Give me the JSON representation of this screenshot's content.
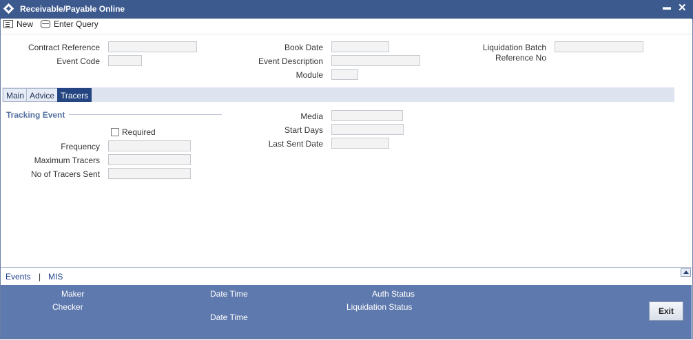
{
  "window": {
    "title": "Receivable/Payable Online",
    "minimize_label": "▬",
    "close_label": "✕"
  },
  "toolbar": {
    "new_label": "New",
    "enter_query_label": "Enter Query"
  },
  "header": {
    "contract_reference_label": "Contract Reference",
    "event_code_label": "Event Code",
    "book_date_label": "Book Date",
    "event_description_label": "Event Description",
    "module_label": "Module",
    "liquidation_batch_label_1": "Liquidation Batch",
    "liquidation_batch_label_2": "Reference No",
    "contract_reference_value": "",
    "event_code_value": "",
    "book_date_value": "",
    "event_description_value": "",
    "module_value": "",
    "liquidation_batch_value": ""
  },
  "tabs": [
    {
      "label": "Main",
      "active": false
    },
    {
      "label": "Advice",
      "active": false
    },
    {
      "label": "Tracers",
      "active": true
    }
  ],
  "tracers": {
    "section_title": "Tracking Event",
    "required_label": "Required",
    "required_checked": false,
    "frequency_label": "Frequency",
    "maximum_tracers_label": "Maximum Tracers",
    "tracers_sent_label": "No of Tracers Sent",
    "media_label": "Media",
    "start_days_label": "Start Days",
    "last_sent_date_label": "Last Sent Date",
    "frequency_value": "",
    "maximum_tracers_value": "",
    "tracers_sent_value": "",
    "media_value": "",
    "start_days_value": "",
    "last_sent_date_value": ""
  },
  "bottom_links": {
    "events_label": "Events",
    "separator": "|",
    "mis_label": "MIS"
  },
  "footer": {
    "maker_label": "Maker",
    "checker_label": "Checker",
    "date_time_label_1": "Date Time",
    "date_time_label_2": "Date Time",
    "auth_status_label": "Auth Status",
    "liquidation_status_label": "Liquidation Status",
    "exit_label": "Exit"
  },
  "colors": {
    "title_bar": "#3d5a8f",
    "footer": "#5e79ad",
    "active_tab": "#244582",
    "link": "#1f3f8a"
  }
}
